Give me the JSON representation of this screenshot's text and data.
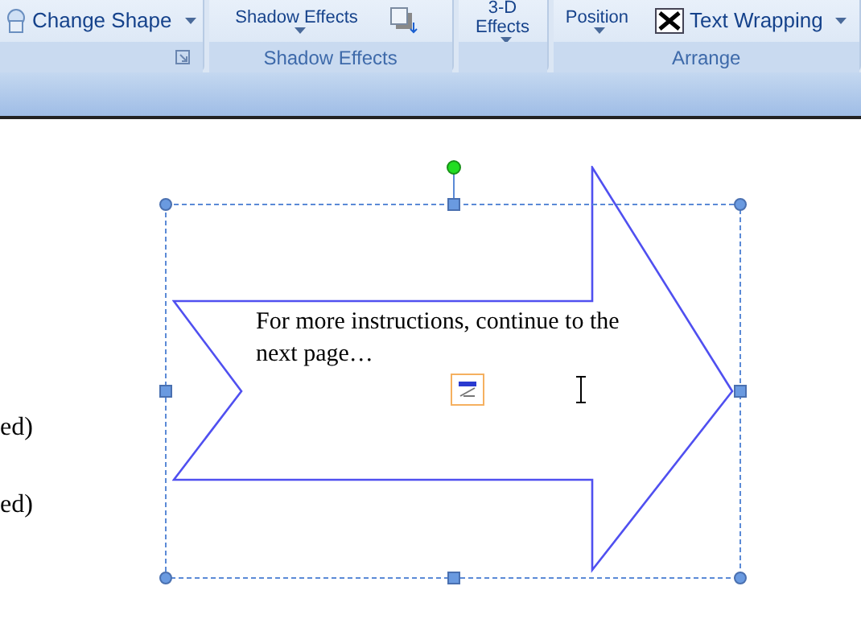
{
  "ribbon": {
    "groups": [
      {
        "launcher": true,
        "buttons": [
          {
            "kind": "icon-text",
            "label": "Change Shape",
            "dropdown": true
          }
        ]
      },
      {
        "label": "Shadow Effects",
        "buttons": [
          {
            "kind": "stacked",
            "label": "Shadow Effects",
            "dropdown": true
          },
          {
            "kind": "icon"
          }
        ]
      },
      {
        "buttons": [
          {
            "kind": "stacked",
            "label": "3-D Effects",
            "dropdown": true
          }
        ]
      },
      {
        "label": "Arrange",
        "buttons": [
          {
            "kind": "stacked",
            "label": "Position",
            "dropdown": true
          },
          {
            "kind": "icon-text",
            "label": "Text Wrapping",
            "dropdown": true
          }
        ]
      }
    ]
  },
  "document": {
    "lines": [
      "ed)",
      "ed)"
    ],
    "shape": {
      "text": "For more instructions, continue to the next page…",
      "selected": true
    }
  }
}
